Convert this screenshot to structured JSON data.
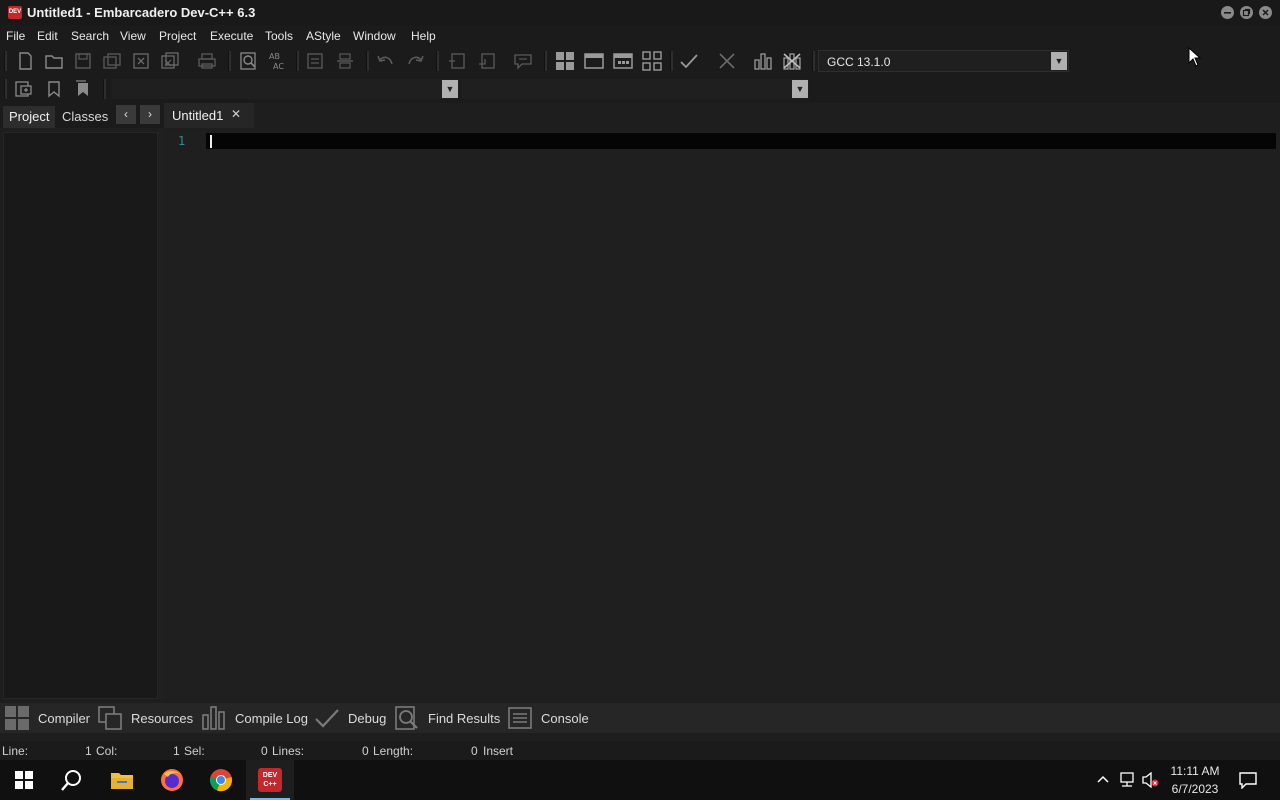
{
  "window": {
    "title": "Untitled1 - Embarcadero Dev-C++ 6.3",
    "app_icon_text": "DEV",
    "controls": [
      "minimize-icon",
      "restore-icon",
      "close-icon"
    ]
  },
  "menu": {
    "items": [
      "File",
      "Edit",
      "Search",
      "View",
      "Project",
      "Execute",
      "Tools",
      "AStyle",
      "Window",
      "Help"
    ]
  },
  "toolbar": {
    "compiler_select": "GCC 13.1.0",
    "class_select": "",
    "function_select": ""
  },
  "left_panel": {
    "tabs": [
      "Project",
      "Classes"
    ],
    "active_tab": "Project",
    "nav_prev": "‹",
    "nav_next": "›"
  },
  "editor": {
    "tab_label": "Untitled1",
    "tab_close": "✕",
    "line_numbers": [
      "1"
    ]
  },
  "bottom_tabs": [
    "Compiler",
    "Resources",
    "Compile Log",
    "Debug",
    "Find Results",
    "Console"
  ],
  "status": {
    "line_label": "Line:",
    "line_value": "1",
    "col_label": "Col:",
    "col_value": "1",
    "sel_label": "Sel:",
    "sel_value": "0",
    "lines_label": "Lines:",
    "lines_value": "0",
    "length_label": "Length:",
    "length_value": "0",
    "mode": "Insert"
  },
  "taskbar": {
    "apps": [
      "windows-start-icon",
      "search-icon",
      "file-explorer-icon",
      "firefox-icon",
      "chrome-icon",
      "devcpp-icon"
    ],
    "devcpp_label": "DEV C++",
    "time": "11:11 AM",
    "date": "6/7/2023"
  },
  "colors": {
    "background": "#1e1e1e",
    "current_line": "#050505",
    "line_number": "#2f8f8f",
    "accent_red": "#c4272c"
  }
}
